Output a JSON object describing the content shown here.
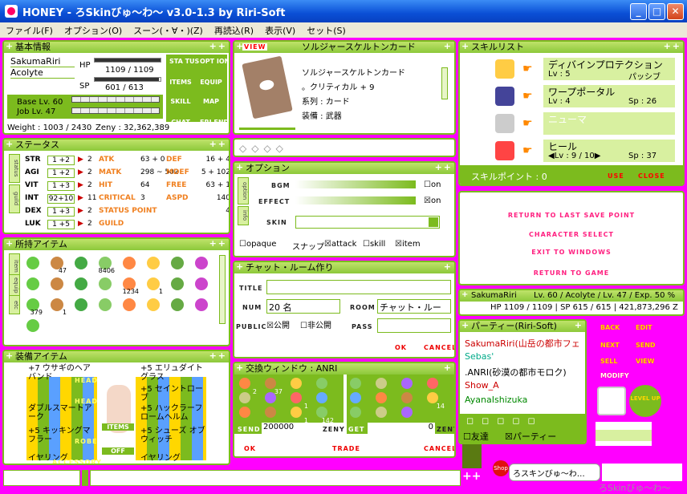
{
  "window": {
    "title": "HONEY - ろSkinびゅ〜わ〜 v3.0-1.3 by Riri-Soft",
    "min": "_",
    "max": "□",
    "close": "✕"
  },
  "menu": [
    "ファイル(F)",
    "オプション(O)",
    "スーン(・∀・)(Z)",
    "再読込(R)",
    "表示(V)",
    "セット(S)"
  ],
  "basic": {
    "title": "基本情報",
    "name": "SakumaRiri",
    "job": "Acolyte",
    "hp_label": "HP",
    "hp": "1109 / 1109",
    "sp_label": "SP",
    "sp": "601 / 613",
    "base_lv": "Base Lv. 60",
    "job_lv": "Job Lv. 47",
    "weight": "Weight : 1003 / 2430",
    "zeny": "Zeny : 32,362,389",
    "hp_fill": 1.0,
    "sp_fill": 0.98,
    "buttons": [
      "STA TUS",
      "OPT ION",
      "ITEMS",
      "EQUIP",
      "SKILL",
      "MAP",
      "CHAT",
      "FRI END"
    ]
  },
  "status": {
    "title": "ステータス",
    "tabs": [
      "status",
      "guild"
    ],
    "rows": [
      {
        "k": "STR",
        "v": "1 +2",
        "p": "2",
        "k2": "ATK",
        "v2": "63 + 0",
        "k3": "DEF",
        "v3": "16 + 4"
      },
      {
        "k": "AGI",
        "v": "1 +2",
        "p": "2",
        "k2": "MATK",
        "v2": "298 ~ 502",
        "k3": "MDEF",
        "v3": "5 + 102"
      },
      {
        "k": "VIT",
        "v": "1 +3",
        "p": "2",
        "k2": "HIT",
        "v2": "64",
        "k3": "FREE",
        "v3": "63 + 1"
      },
      {
        "k": "INT",
        "v": "92+10",
        "p": "11",
        "k2": "CRITICAL",
        "v2": "3",
        "k3": "ASPD",
        "v3": "140"
      },
      {
        "k": "DEX",
        "v": "1 +3",
        "p": "2",
        "k2": "STATUS POINT",
        "v2": "",
        "k3": "",
        "v3": "4"
      },
      {
        "k": "LUK",
        "v": "1 +5",
        "p": "2",
        "k2": "GUILD",
        "v2": "",
        "k3": "",
        "v3": ""
      }
    ]
  },
  "items": {
    "title": "所持アイテム",
    "tabs": [
      "item",
      "equip",
      "etc"
    ],
    "counts": [
      "",
      "47",
      "",
      "8406",
      "",
      "",
      "",
      "",
      "",
      "",
      "",
      "",
      "1234",
      "1",
      "",
      "",
      "379",
      "1",
      "",
      "",
      "",
      "",
      "",
      "",
      ""
    ]
  },
  "equip": {
    "title": "装備アイテム",
    "left": [
      "+7 ウサギのヘアバンド",
      "ダブルスマートアーク",
      "+5 キッキングマフラー",
      "イヤリング"
    ],
    "right": [
      "+5 エリュダイトグラス",
      "+5 セイントローブ",
      "+5 ハックラーフロームヘルム",
      "+5 シューズ オブウィッチ",
      "イヤリング"
    ],
    "tags": [
      "HEAD",
      "HEAD",
      "ROBE",
      "ACCESSORY",
      "HEAD",
      "HEAD",
      "ARMOR",
      "ACCESSORY"
    ],
    "center": [
      "ITEMS",
      "OFF"
    ]
  },
  "card": {
    "title": "ソルジャースケルトンカード",
    "view": "VIEW",
    "lines": [
      "ソルジャースケルトンカード",
      "。クリティカル + 9",
      "系列 : カード",
      "装備 : 武器"
    ]
  },
  "option": {
    "title": "オプション",
    "tabs": [
      "option",
      "info"
    ],
    "bgm": "BGM",
    "effect": "EFFECT",
    "skin": "SKIN",
    "on1": "on",
    "on2": "on",
    "opaque": "opaque",
    "snap": "スナップ",
    "attack": "attack",
    "skill": "skill",
    "item": "item"
  },
  "chat": {
    "title": "チャット・ルーム作り",
    "title_lbl": "TITLE",
    "num_lbl": "NUM",
    "num": "20 名",
    "room_lbl": "ROOM",
    "room": "チャット・ルー",
    "public_lbl": "PUBLIC",
    "public": "公開",
    "private": "非公開",
    "pass_lbl": "PASS",
    "ok": "OK",
    "cancel": "CANCEL"
  },
  "trade": {
    "title": "交換ウィンドウ : ANRI",
    "counts_l": [
      "2",
      "37",
      "",
      "",
      "",
      "",
      "1",
      "",
      "",
      "",
      "1",
      "142"
    ],
    "counts_r": [
      "",
      "",
      "",
      "",
      "",
      "",
      "",
      "14",
      "",
      "",
      ""
    ],
    "send": "SEND",
    "zeny_l": "200000",
    "zeny_lbl": "ZENY",
    "get": "GET",
    "zeny_r": "0",
    "ok": "OK",
    "trade": "TRADE",
    "cancel": "CANCEL"
  },
  "skills": {
    "title": "スキルリスト",
    "list": [
      {
        "name": "ディバインプロテクション",
        "lv": "Lv : 5",
        "info": "パッシブ"
      },
      {
        "name": "ワープポータル",
        "lv": "Lv : 4",
        "info": "Sp : 26"
      },
      {
        "name": "ニューマ",
        "lv": "",
        "info": ""
      },
      {
        "name": "ヒール",
        "lv": "◀Lv :  9  / 10▶",
        "info": "Sp : 37"
      }
    ],
    "points": "スキルポイント : 0",
    "use": "USE",
    "close": "CLOSE"
  },
  "esc": [
    "RETURN TO LAST SAVE POINT",
    "CHARACTER SELECT",
    "EXIT TO WINDOWS",
    "RETURN TO GAME"
  ],
  "summary": {
    "name": "SakumaRiri",
    "info": "Lv. 60 / Acolyte / Lv. 47 / Exp. 50 %",
    "stats": "HP 1109 / 1109  |  SP 615 / 615  |  421,873,296 Z"
  },
  "party": {
    "title": "パーティー(Riri-Soft)",
    "members": [
      "SakumaRiri(山岳の都市フェ",
      "Sebas'",
      ".ANRI(砂漠の都市モロク)",
      "Show_A",
      "AyanaIshizuka"
    ],
    "friends": "友達",
    "party_btn": "パーティー"
  },
  "side": {
    "back": "BACK",
    "edit": "EDIT",
    "next": "NEXT",
    "send": "SEND",
    "sell": "SELL",
    "view": "VIEW",
    "modify": "MODIFY",
    "levelup": "LEVEL UP"
  },
  "bottom": {
    "shop": "Shop",
    "chat": "ろスキンびゅ〜わ…",
    "brand": "ろSkinびゅ〜わ〜"
  },
  "colors": {
    "accent": "#7cbb1e",
    "bg": "#ff00ff",
    "pink": "#ff2080"
  }
}
